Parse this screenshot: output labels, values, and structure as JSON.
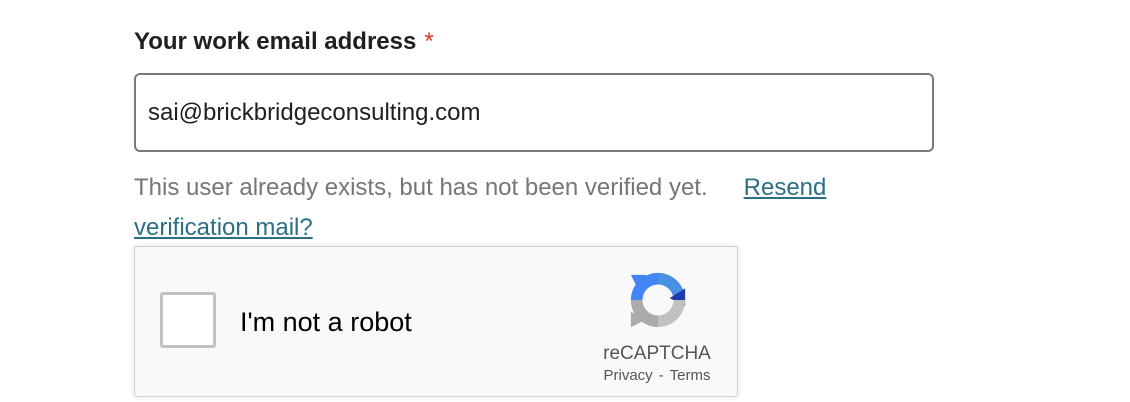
{
  "form": {
    "email_label": "Your work email address",
    "required_marker": "*",
    "email_value": "sai@brickbridgeconsulting.com",
    "message_text": "This user already exists, but has not been verified yet.",
    "resend_link": "Resend verification mail?"
  },
  "recaptcha": {
    "checkbox_label": "I'm not a robot",
    "brand": "reCAPTCHA",
    "privacy_link": "Privacy",
    "separator": "-",
    "terms_link": "Terms",
    "logo": "recaptcha-logo-icon"
  },
  "colors": {
    "link": "#2b6f86",
    "required": "#d9342b",
    "message": "#767676"
  }
}
